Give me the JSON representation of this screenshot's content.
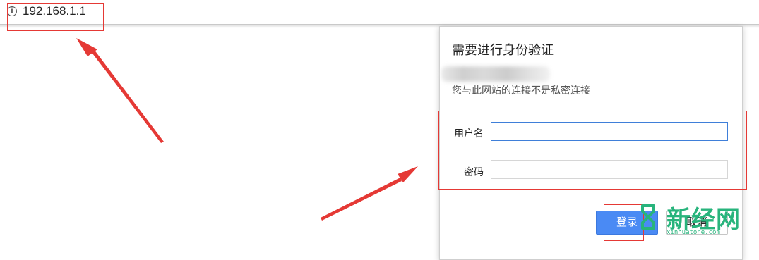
{
  "address_bar": {
    "url": "192.168.1.1",
    "info_icon": "info-icon",
    "info_glyph": "i"
  },
  "auth_dialog": {
    "title": "需要进行身份验证",
    "subtitle": "您与此网站的连接不是私密连接",
    "username_label": "用户名",
    "username_value": "",
    "password_label": "密码",
    "password_value": "",
    "login_button": "登录",
    "cancel_button": "取消"
  },
  "watermark": {
    "brand": "新经网",
    "url": "xinhuatone.com"
  },
  "colors": {
    "annotation_red": "#e53935",
    "primary_button": "#4a8af4",
    "watermark_green": "#28b47c",
    "focus_border": "#3f7fd9"
  }
}
